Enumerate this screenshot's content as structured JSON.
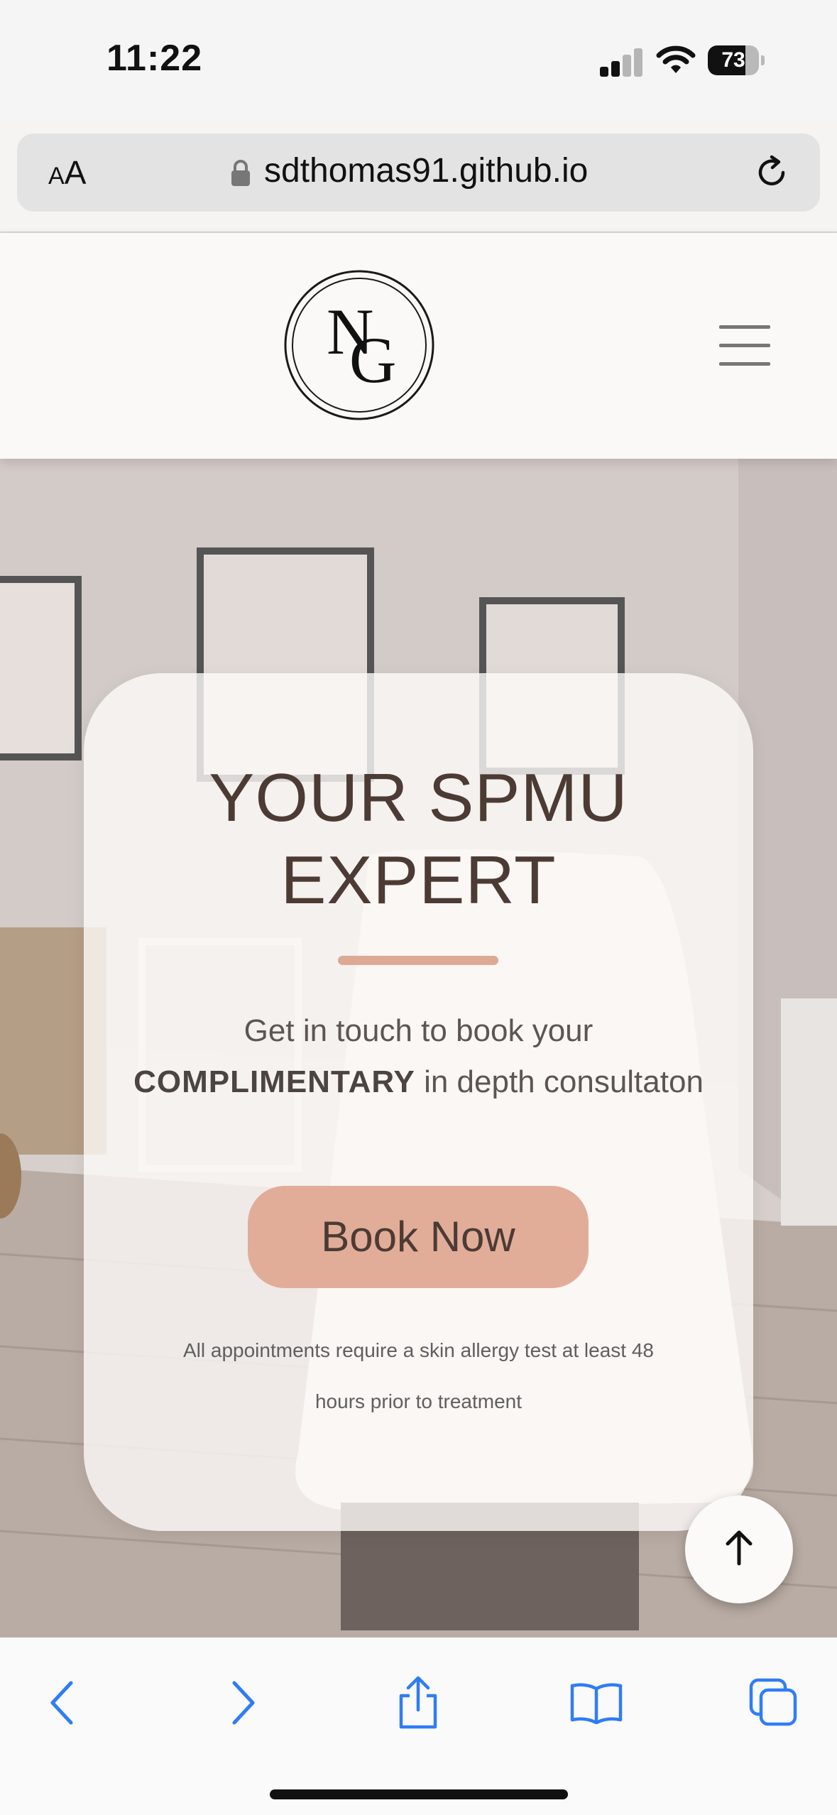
{
  "status_bar": {
    "time": "11:22",
    "battery": "73",
    "battery_level": 0.73
  },
  "url_bar": {
    "text_size": "AA",
    "url": "sdthomas91.github.io"
  },
  "site_header": {
    "logo_text": "NG"
  },
  "hero": {
    "title": "YOUR SPMU EXPERT",
    "text_before": "Get in touch to book your ",
    "text_emphasis": "COMPLIMENTARY",
    "text_after": " in depth consultaton",
    "button": "Book Now",
    "disclaimer": "All appointments require a skin allergy test at least 48 hours prior to treatment"
  },
  "colors": {
    "accent": "#e1ad99",
    "title": "#4c3b34",
    "browser_blue": "#2f7cf6"
  }
}
